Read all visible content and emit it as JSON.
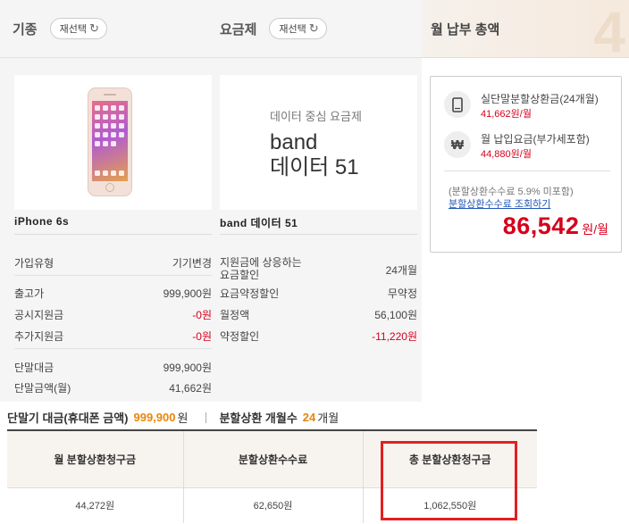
{
  "device_column": {
    "title": "기종",
    "reselect_label": "재선택",
    "product_name": "iPhone 6s",
    "rows": [
      {
        "label": "가입유형",
        "value": "기기변경"
      },
      {
        "label": "출고가",
        "value": "999,900원"
      },
      {
        "label": "공시지원금",
        "value": "-0원"
      },
      {
        "label": "추가지원금",
        "value": "-0원"
      },
      {
        "label": "단말대금",
        "value": "999,900원"
      },
      {
        "label": "단말금액(월)",
        "value": "41,662원"
      }
    ]
  },
  "plan_column": {
    "title": "요금제",
    "reselect_label": "재선택",
    "image_category": "데이터 중심 요금제",
    "image_name_line1": "band",
    "image_name_line2": "데이터 51",
    "product_name": "band 데이터 51",
    "rows": [
      {
        "label": "지원금에 상응하는\n요금할인",
        "value": "24개월"
      },
      {
        "label": "요금약정할인",
        "value": "무약정"
      },
      {
        "label": "월정액",
        "value": "56,100원"
      },
      {
        "label": "약정할인",
        "value": "-11,220원"
      }
    ]
  },
  "total_column": {
    "title": "월 납부 총액",
    "deco_char": "4",
    "items": [
      {
        "label": "실단말분할상환금(24개월)",
        "value": "41,662원/월",
        "icon": "phone-icon"
      },
      {
        "label": "월 납입요금(부가세포함)",
        "value": "44,880원/월",
        "icon": "won-icon"
      }
    ],
    "won_symbol": "₩",
    "fee_note": "(분할상환수수료 5.9% 미포함)",
    "fee_link": "분할상환수수료 조회하기",
    "total_value": "86,542",
    "total_unit": "원/월"
  },
  "installment": {
    "price_label": "단말기 대금(휴대폰 금액)",
    "price_value": "999,900",
    "price_unit": "원",
    "months_label": "분할상환 개월수",
    "months_value": "24",
    "months_unit": "개월"
  },
  "table": {
    "headers": [
      "월 분할상환청구금",
      "분할상환수수료",
      "총 분할상환청구금"
    ],
    "row": [
      "44,272원",
      "62,650원",
      "1,062,550원"
    ]
  },
  "colors": {
    "accent_red": "#d6001c",
    "highlight_red": "#e32021",
    "orange": "#e8860a",
    "link_blue": "#2357b5"
  }
}
